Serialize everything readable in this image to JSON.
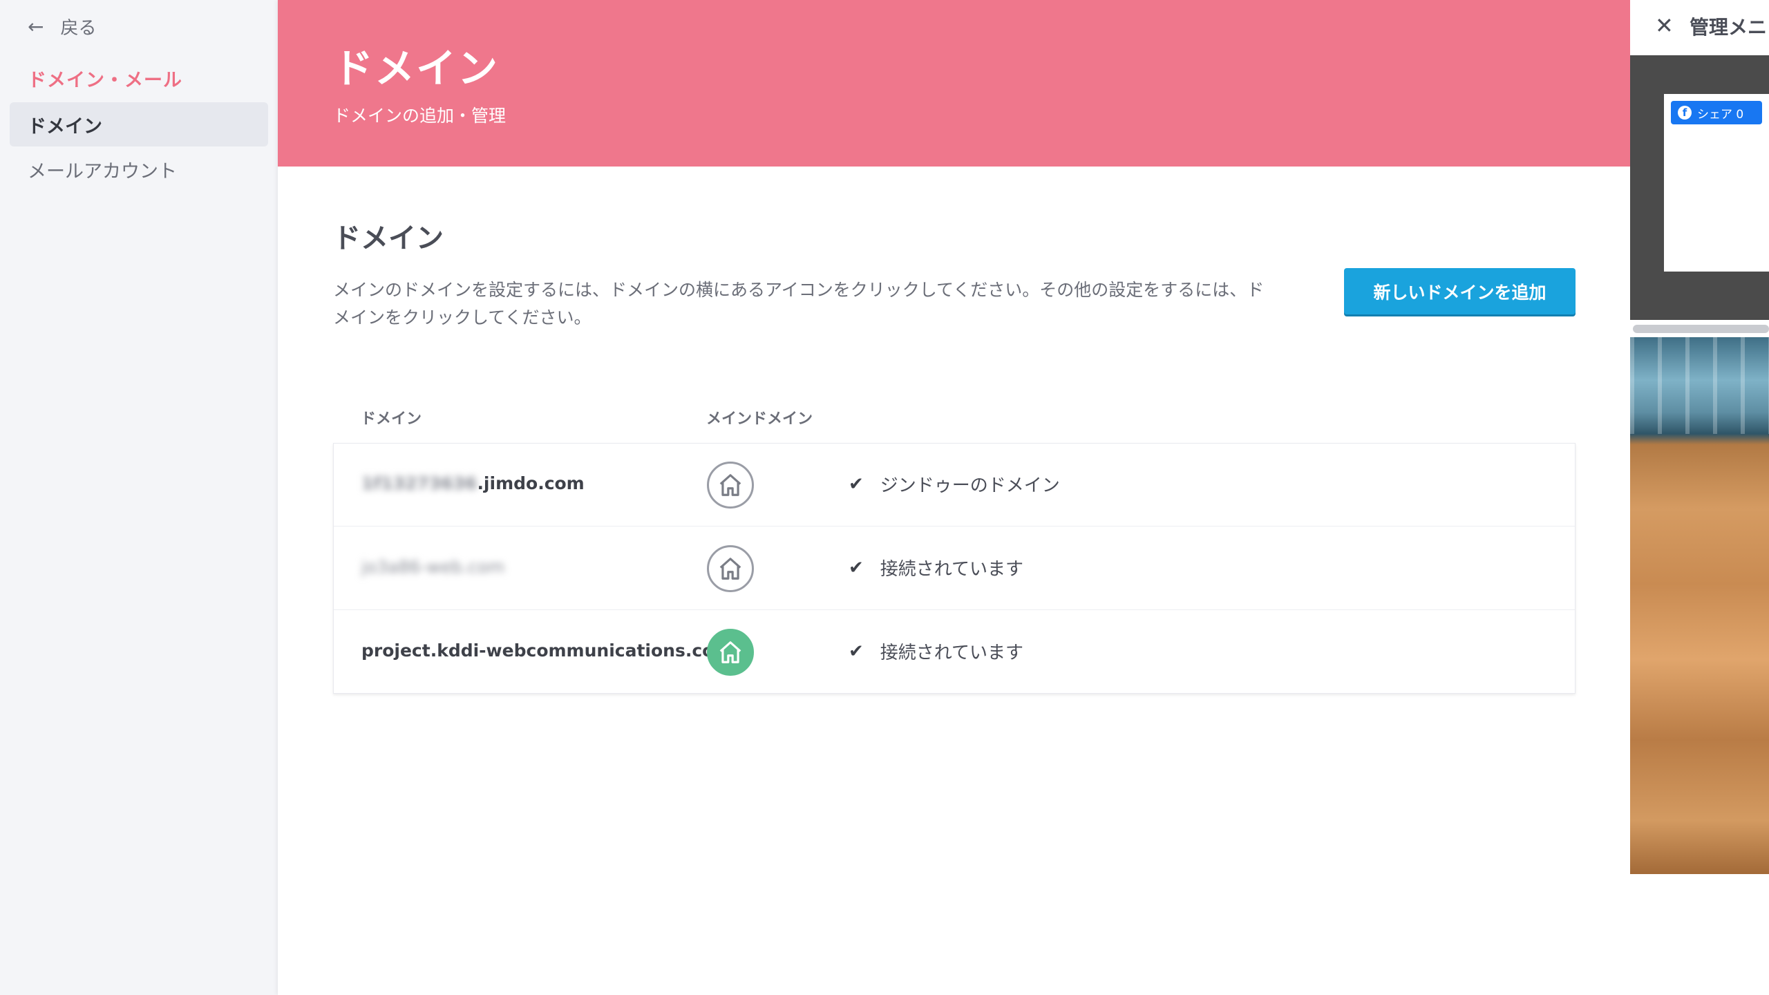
{
  "sidebar": {
    "back_label": "戻る",
    "section_title": "ドメイン・メール",
    "items": [
      {
        "label": "ドメイン",
        "active": true
      },
      {
        "label": "メールアカウント",
        "active": false
      }
    ]
  },
  "header": {
    "title": "ドメイン",
    "subtitle": "ドメインの追加・管理"
  },
  "content": {
    "title": "ドメイン",
    "description": "メインのドメインを設定するには、ドメインの横にあるアイコンをクリックしてください。その他の設定をするには、ドメインをクリックしてください。",
    "add_button_label": "新しいドメインを追加"
  },
  "table": {
    "columns": [
      "ドメイン",
      "メインドメイン"
    ],
    "rows": [
      {
        "domain_prefix": "1f13273636",
        "domain_suffix": ".jimdo.com",
        "status": "ジンドゥーのドメイン",
        "is_main": false
      },
      {
        "domain_prefix": "",
        "domain_suffix": "jo3a86-web.com",
        "status": "接続されています",
        "is_main": false
      },
      {
        "domain_prefix": "",
        "domain_suffix": "project.kddi-webcommunications.co.jp",
        "status": "接続されています",
        "is_main": true
      }
    ]
  },
  "preview": {
    "title": "管理メニュー",
    "share_label": "シェア 0"
  },
  "colors": {
    "accent_pink": "#ef778c",
    "button_blue": "#1aa3dd",
    "main_domain_green": "#5bbf8e"
  },
  "icons": [
    "arrow-left-icon",
    "home-icon",
    "check-icon",
    "close-icon",
    "facebook-icon"
  ]
}
